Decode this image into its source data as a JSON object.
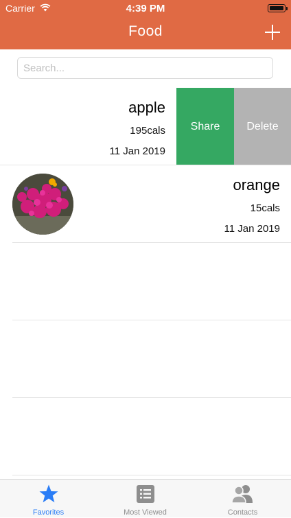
{
  "status_bar": {
    "carrier": "Carrier",
    "time": "4:39 PM"
  },
  "nav": {
    "title": "Food"
  },
  "search": {
    "placeholder": "Search..."
  },
  "rows": [
    {
      "name": "apple",
      "calories": "195cals",
      "date": "11 Jan 2019",
      "actions": {
        "share": "Share",
        "delete": "Delete"
      }
    },
    {
      "name": "orange",
      "calories": "15cals",
      "date": "11 Jan 2019"
    }
  ],
  "tabs": [
    {
      "label": "Favorites",
      "icon": "star-icon",
      "active": true
    },
    {
      "label": "Most Viewed",
      "icon": "list-icon",
      "active": false
    },
    {
      "label": "Contacts",
      "icon": "contacts-icon",
      "active": false
    }
  ],
  "colors": {
    "nav": "#E06A44",
    "share": "#35A862",
    "delete": "#B3B3B3",
    "active_tab": "#2a7df6",
    "inactive_tab": "#8e8e8e"
  }
}
